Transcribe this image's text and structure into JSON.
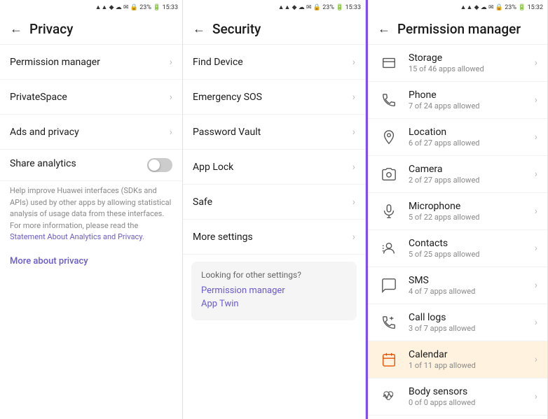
{
  "panels": [
    {
      "id": "privacy",
      "statusBar": "▲ ◀ ◆ 🔒 23% 15:33",
      "title": "Privacy",
      "items": [
        {
          "label": "Permission manager",
          "type": "nav"
        },
        {
          "label": "PrivateSpace",
          "type": "nav"
        },
        {
          "label": "Ads and privacy",
          "type": "nav"
        },
        {
          "label": "Share analytics",
          "type": "toggle",
          "value": false
        },
        {
          "helpText": "Help improve Huawei interfaces (SDKs and APIs) used by other apps by allowing statistical analysis of usage data from these interfaces. For more information, please read the Statement About Analytics and Privacy."
        },
        {
          "label": "More about privacy",
          "type": "link"
        }
      ]
    },
    {
      "id": "security",
      "statusBar": "▲ ◀ ◆ 🔒 23% 15:33",
      "title": "Security",
      "items": [
        {
          "label": "Find Device",
          "type": "nav"
        },
        {
          "label": "Emergency SOS",
          "type": "nav"
        },
        {
          "label": "Password Vault",
          "type": "nav"
        },
        {
          "label": "App Lock",
          "type": "nav"
        },
        {
          "label": "Safe",
          "type": "nav"
        },
        {
          "label": "More settings",
          "type": "nav"
        }
      ],
      "suggestion": {
        "title": "Looking for other settings?",
        "links": [
          "Permission manager",
          "App Twin"
        ]
      }
    },
    {
      "id": "permission-manager",
      "statusBar": "▲ ◀ ◆ 🔒 23% 15:32",
      "title": "Permission manager",
      "permissions": [
        {
          "name": "Storage",
          "sub": "15 of 46 apps allowed",
          "icon": "storage"
        },
        {
          "name": "Phone",
          "sub": "7 of 24 apps allowed",
          "icon": "phone"
        },
        {
          "name": "Location",
          "sub": "6 of 27 apps allowed",
          "icon": "location"
        },
        {
          "name": "Camera",
          "sub": "2 of 27 apps allowed",
          "icon": "camera"
        },
        {
          "name": "Microphone",
          "sub": "5 of 22 apps allowed",
          "icon": "microphone"
        },
        {
          "name": "Contacts",
          "sub": "5 of 25 apps allowed",
          "icon": "contacts"
        },
        {
          "name": "SMS",
          "sub": "4 of 7 apps allowed",
          "icon": "sms"
        },
        {
          "name": "Call logs",
          "sub": "3 of 7 apps allowed",
          "icon": "call-logs"
        },
        {
          "name": "Calendar",
          "sub": "1 of 11 app allowed",
          "icon": "calendar",
          "highlighted": true
        },
        {
          "name": "Body sensors",
          "sub": "0 of 0 apps allowed",
          "icon": "body-sensors"
        }
      ]
    }
  ]
}
